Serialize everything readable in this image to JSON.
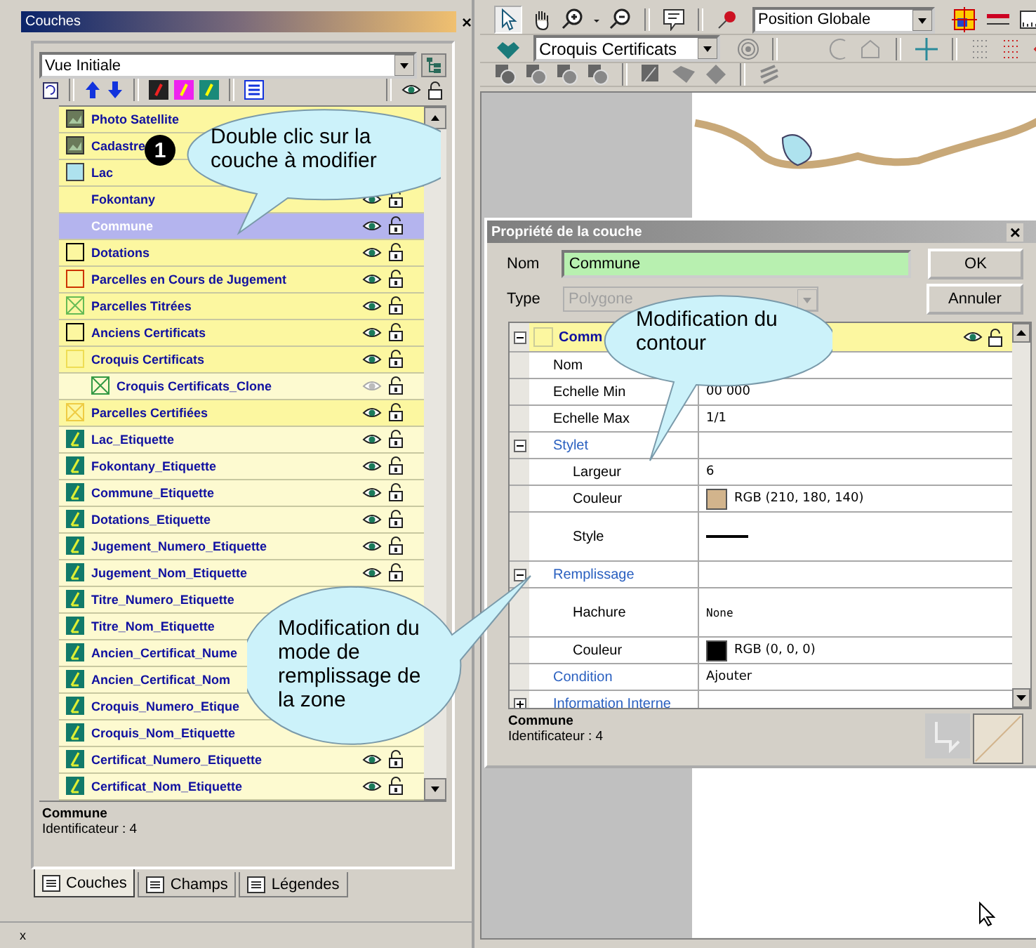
{
  "layers_panel": {
    "title": "Couches",
    "close": "×",
    "view_combo": {
      "value": "Vue Initiale"
    },
    "layers": [
      {
        "name": "Photo Satellite",
        "kind": "image",
        "selected": false
      },
      {
        "name": "Cadastre",
        "kind": "image",
        "selected": false
      },
      {
        "name": "Lac",
        "kind": "fill",
        "color": "#aee2ee",
        "selected": false
      },
      {
        "name": "Fokontany",
        "kind": "blank",
        "selected": false,
        "visible": true
      },
      {
        "name": "Commune",
        "kind": "blank",
        "selected": true,
        "visible": true
      },
      {
        "name": "Dotations",
        "kind": "outline",
        "color": "#000000",
        "selected": false,
        "visible": true
      },
      {
        "name": "Parcelles en Cours de Jugement",
        "kind": "outline",
        "color": "#cc3300",
        "selected": false,
        "visible": true
      },
      {
        "name": "Parcelles Titrées",
        "kind": "hatch",
        "color": "#66bb55",
        "selected": false,
        "visible": true
      },
      {
        "name": "Anciens Certificats",
        "kind": "outline",
        "color": "#000000",
        "selected": false,
        "visible": true
      },
      {
        "name": "Croquis Certificats",
        "kind": "outline",
        "color": "#eedd55",
        "selected": false,
        "visible": true,
        "children": [
          {
            "name": "Croquis Certificats_Clone",
            "kind": "hatch",
            "color": "#339944",
            "selected": false,
            "visible": false
          }
        ]
      },
      {
        "name": "Parcelles Certifiées",
        "kind": "hatch",
        "color": "#eecc44",
        "selected": false,
        "visible": true
      },
      {
        "name": "Lac_Etiquette",
        "kind": "label",
        "selected": false,
        "visible": true
      },
      {
        "name": "Fokontany_Etiquette",
        "kind": "label",
        "selected": false,
        "visible": true
      },
      {
        "name": "Commune_Etiquette",
        "kind": "label",
        "selected": false,
        "visible": true
      },
      {
        "name": "Dotations_Etiquette",
        "kind": "label",
        "selected": false,
        "visible": true
      },
      {
        "name": "Jugement_Numero_Etiquette",
        "kind": "label",
        "selected": false,
        "visible": true
      },
      {
        "name": "Jugement_Nom_Etiquette",
        "kind": "label",
        "selected": false,
        "visible": true
      },
      {
        "name": "Titre_Numero_Etiquette",
        "kind": "label",
        "selected": false
      },
      {
        "name": "Titre_Nom_Etiquette",
        "kind": "label",
        "selected": false
      },
      {
        "name": "Ancien_Certificat_Nume",
        "kind": "label",
        "selected": false
      },
      {
        "name": "Ancien_Certificat_Nom",
        "kind": "label",
        "selected": false
      },
      {
        "name": "Croquis_Numero_Etique",
        "kind": "label",
        "selected": false
      },
      {
        "name": "Croquis_Nom_Etiquette",
        "kind": "label",
        "selected": false
      },
      {
        "name": "Certificat_Numero_Etiquette",
        "kind": "label",
        "selected": false,
        "visible": true
      },
      {
        "name": "Certificat_Nom_Etiquette",
        "kind": "label",
        "selected": false,
        "visible": true
      }
    ],
    "info": {
      "name": "Commune",
      "detail": "Identificateur : 4"
    },
    "tabs": [
      {
        "label": "Couches",
        "selected": true
      },
      {
        "label": "Champs",
        "selected": false
      },
      {
        "label": "Légendes",
        "selected": false
      }
    ],
    "footer_close": "x"
  },
  "toolbar": {
    "position_combo": {
      "value": "Position Globale"
    },
    "layer_combo": {
      "value": "Croquis Certificats"
    }
  },
  "dialog": {
    "title": "Propriété de la couche",
    "close": "×",
    "name_label": "Nom",
    "name_value": "Commune",
    "type_label": "Type",
    "type_value": "Polygone",
    "ok": "OK",
    "cancel": "Annuler",
    "grid": {
      "header": {
        "label": "Comm",
        "expanded": true,
        "visible": true
      },
      "rows": [
        {
          "kind": "text",
          "label": "Nom"
        },
        {
          "kind": "text",
          "label": "Echelle Min",
          "value": "00 000"
        },
        {
          "kind": "text",
          "label": "Echelle Max",
          "value": "1/1"
        },
        {
          "kind": "group",
          "label": "Stylet",
          "expanded": true,
          "children": [
            {
              "kind": "text",
              "label": "Largeur",
              "value": "6"
            },
            {
              "kind": "swatch",
              "label": "Couleur",
              "value": "RGB (210, 180, 140)",
              "color": "#d2b48c"
            },
            {
              "kind": "line",
              "label": "Style"
            }
          ]
        },
        {
          "kind": "group",
          "label": "Remplissage",
          "expanded": true,
          "children": [
            {
              "kind": "hatch",
              "label": "Hachure",
              "value": "None"
            },
            {
              "kind": "swatch",
              "label": "Couleur",
              "value": "RGB (0, 0, 0)",
              "color": "#000000"
            }
          ]
        },
        {
          "kind": "link",
          "label": "Condition",
          "value": "Ajouter"
        },
        {
          "kind": "group",
          "label": "Information Interne",
          "expanded": false
        }
      ]
    },
    "info": {
      "name": "Commune",
      "detail": "Identificateur : 4"
    }
  },
  "step_badge": "1",
  "callouts": [
    {
      "text": "Double clic sur la couche à modifier"
    },
    {
      "text": "Modification du contour"
    },
    {
      "text": "Modification du mode de remplissage de la zone"
    }
  ]
}
